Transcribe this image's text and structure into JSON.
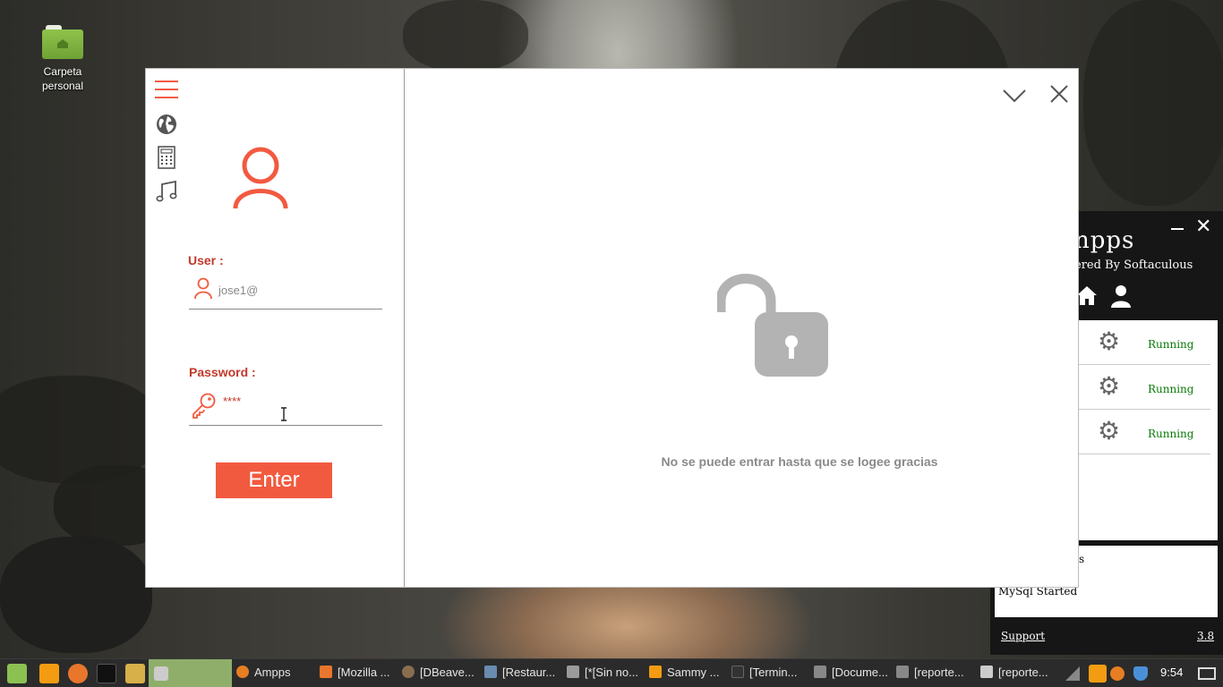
{
  "desktop": {
    "icon_label_line1": "Carpeta",
    "icon_label_line2": "personal"
  },
  "ampps": {
    "title": "npps",
    "subtitle": "ered By Softaculous",
    "services": [
      {
        "status": "Running"
      },
      {
        "status": "Running"
      },
      {
        "status": "Running"
      }
    ],
    "log_line1": "s",
    "log_line2": "MySql Started",
    "support_link": "Support",
    "version": "3.8"
  },
  "login": {
    "user_label": "User  :",
    "user_value": "jose1@",
    "password_label": "Password :",
    "password_value": "****",
    "enter_button": "Enter",
    "locked_message": "No se puede entrar hasta que se logee gracias"
  },
  "colors": {
    "accent": "#f25a40",
    "label": "#c0392b",
    "running": "#0a7a0a"
  },
  "icons": {
    "sidebar": [
      "menu-icon",
      "globe-icon",
      "calculator-icon",
      "music-icon"
    ],
    "window": [
      "chevron-down-icon",
      "close-icon"
    ]
  },
  "taskbar": {
    "tasks": [
      {
        "label": "Ampps",
        "icon_color": "#e67e22"
      },
      {
        "label": "[Mozilla ...",
        "icon_color": "#e8762d"
      },
      {
        "label": "[DBeave...",
        "icon_color": "#8a6d4f"
      },
      {
        "label": "[Restaur...",
        "icon_color": "#6a8caf"
      },
      {
        "label": "[*[Sin no...",
        "icon_color": "#9b9b9b"
      },
      {
        "label": "Sammy ...",
        "icon_color": "#f39c12"
      },
      {
        "label": "[Termin...",
        "icon_color": "#333333"
      },
      {
        "label": "[Docume...",
        "icon_color": "#888888"
      },
      {
        "label": "[reporte...",
        "icon_color": "#888888"
      },
      {
        "label": "[reporte...",
        "icon_color": "#cccccc"
      }
    ],
    "clock": "9:54"
  }
}
